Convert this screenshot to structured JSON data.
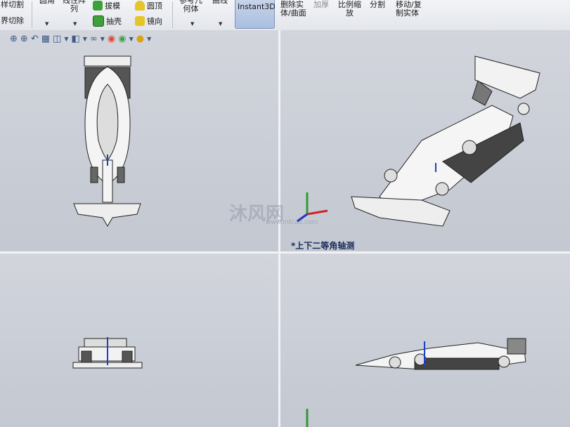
{
  "ribbon": {
    "left_top": "样切割",
    "left_bottom": "界切除",
    "fillet": "圆角",
    "linear_pattern": "线性阵\n列",
    "draft": "拔模",
    "shell": "抽壳",
    "dome": "圆顶",
    "mirror": "镜向",
    "ref_geometry": "参考几\n何体",
    "curves": "曲线",
    "instant3d": "Instant3D",
    "delete_body": "删除实\n体/曲面",
    "thicken": "加厚",
    "scale": "比例缩\n放",
    "split": "分割",
    "move_copy": "移动/复\n制实体"
  },
  "hud": {
    "zoom": "⊕",
    "zoom_area": "⊕",
    "prev_view": "↶",
    "section": "▦",
    "view_orient": "◫",
    "display_style": "◧",
    "hide_show": "∞",
    "appearance": "◉",
    "scene": "●"
  },
  "viewports": {
    "iso_label": "*上下二等角轴测"
  },
  "watermark": {
    "main": "沐风网",
    "sub": "www.mfcad.com"
  },
  "colors": {
    "accent": "#3b5a86",
    "viewport_bg": "#c9ced6"
  }
}
